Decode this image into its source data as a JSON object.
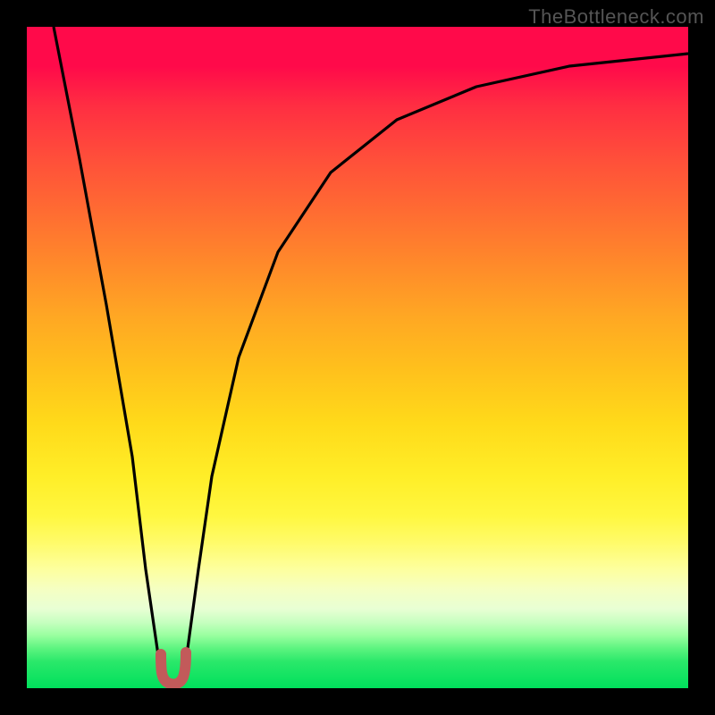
{
  "watermark": "TheBottleneck.com",
  "chart_data": {
    "type": "line",
    "title": "",
    "xlabel": "",
    "ylabel": "",
    "xlim": [
      0,
      100
    ],
    "ylim": [
      0,
      100
    ],
    "grid": false,
    "legend": false,
    "series": [
      {
        "name": "bottleneck-curve",
        "x": [
          4,
          8,
          12,
          16,
          18,
          20,
          21,
          22,
          23,
          24,
          26,
          28,
          32,
          38,
          46,
          56,
          68,
          82,
          100
        ],
        "y": [
          100,
          80,
          58,
          35,
          18,
          4,
          1,
          0.5,
          1,
          4,
          18,
          32,
          50,
          66,
          78,
          86,
          91,
          94,
          96
        ]
      }
    ],
    "background_gradient": {
      "top": "#ff0a4a",
      "mid_upper": "#ff8a2a",
      "mid": "#ffee28",
      "mid_lower": "#fdff9e",
      "bottom": "#00e05c"
    },
    "marker": {
      "name": "optimal-region",
      "x_center": 22,
      "width": 3,
      "color": "#c25a5a"
    }
  }
}
